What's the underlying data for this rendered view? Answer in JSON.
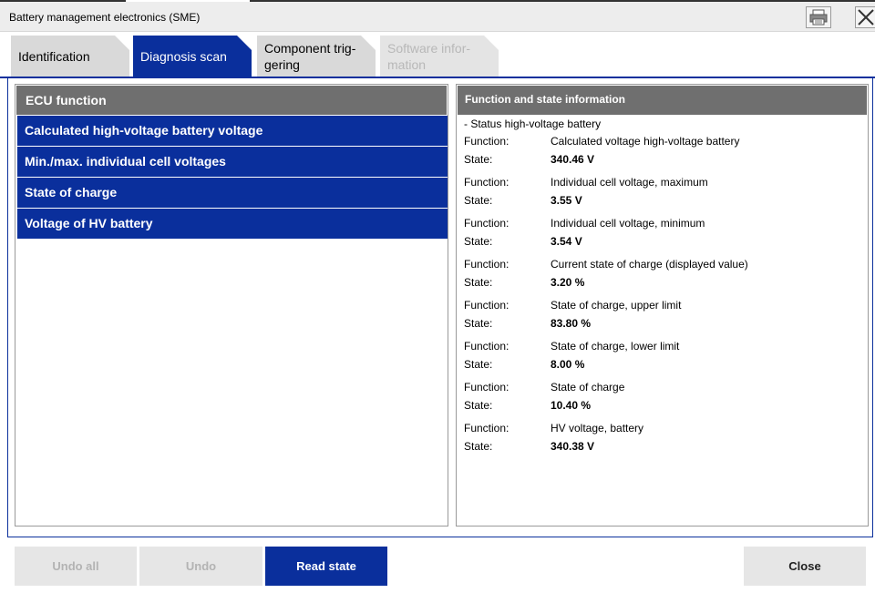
{
  "window": {
    "title": "Battery management electronics (SME)"
  },
  "toolbar": {
    "print_icon": "printer-icon",
    "close_icon": "close-icon"
  },
  "tabs": [
    {
      "label": "Identification",
      "state": "normal"
    },
    {
      "label": "Diagnosis scan",
      "state": "active"
    },
    {
      "label": "Component trig-\ngering",
      "state": "normal"
    },
    {
      "label": "Software infor-\nmation",
      "state": "disabled"
    }
  ],
  "left": {
    "header": "ECU function",
    "items": [
      "Calculated high-voltage battery voltage",
      "Min./max. individual cell voltages",
      "State of charge",
      "Voltage of HV battery"
    ]
  },
  "right": {
    "header": "Function and state information",
    "group": "- Status high-voltage battery",
    "function_label": "Function:",
    "state_label": "State:",
    "entries": [
      {
        "function": "Calculated voltage high-voltage battery",
        "state": "340.46  V"
      },
      {
        "function": "Individual cell voltage, maximum",
        "state": "3.55  V"
      },
      {
        "function": "Individual cell voltage, minimum",
        "state": "3.54  V"
      },
      {
        "function": "Current state of charge (displayed value)",
        "state": "3.20  %"
      },
      {
        "function": "State of charge, upper limit",
        "state": "83.80  %"
      },
      {
        "function": "State of charge, lower limit",
        "state": "8.00  %"
      },
      {
        "function": "State of charge",
        "state": "10.40  %"
      },
      {
        "function": "HV voltage, battery",
        "state": "340.38  V"
      }
    ]
  },
  "buttons": {
    "undo_all": "Undo all",
    "undo": "Undo",
    "read_state": "Read state",
    "close": "Close"
  },
  "colors": {
    "accent": "#0a2f9c",
    "header_gray": "#6f6f6f",
    "tab_gray": "#d9d9d9"
  }
}
